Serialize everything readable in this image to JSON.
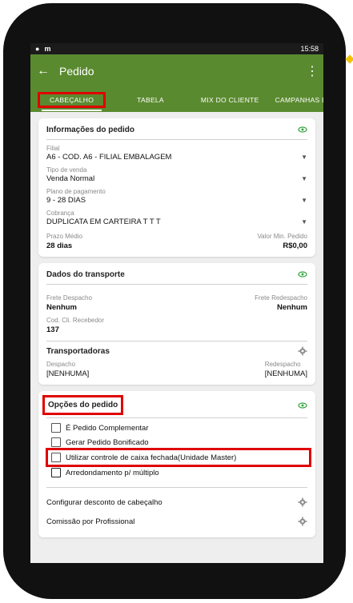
{
  "status": {
    "left_icon_a": "android-icon",
    "left_icon_b": "notification-icon",
    "time": "15:58"
  },
  "appbar": {
    "title": "Pedido"
  },
  "tabs": [
    "CABEÇALHO",
    "TABELA",
    "MIX DO CLIENTE",
    "CAMPANHAS DE"
  ],
  "info": {
    "title": "Informações do pedido",
    "filial_label": "Filial",
    "filial_value": "A6 - COD. A6 - FILIAL EMBALAGEM",
    "tipo_label": "Tipo de venda",
    "tipo_value": "Venda Normal",
    "plano_label": "Plano de pagamento",
    "plano_value": "9 - 28 DIAS",
    "cobranca_label": "Cobrança",
    "cobranca_value": "DUPLICATA EM CARTEIRA T T T",
    "prazo_label": "Prazo Médio",
    "prazo_value": "28 dias",
    "valor_label": "Valor Min. Pedido",
    "valor_value": "R$0,00"
  },
  "transporte": {
    "title": "Dados do transporte",
    "frete_desp_label": "Frete Despacho",
    "frete_desp_value": "Nenhum",
    "frete_redesp_label": "Frete Redespacho",
    "frete_redesp_value": "Nenhum",
    "cod_label": "Cod. Cli. Recebedor",
    "cod_value": "137",
    "transportadoras_title": "Transportadoras",
    "despacho_label": "Despacho",
    "despacho_value": "[NENHUMA]",
    "redespacho_label": "Redespacho",
    "redespacho_value": "[NENHUMA]"
  },
  "opcoes": {
    "title": "Opções do pedido",
    "checks": [
      "É Pedido Complementar",
      "Gerar Pedido Bonificado",
      "Utilizar controle de caixa fechada(Unidade Master)",
      "Arredondamento p/ múltiplo"
    ],
    "link1": "Configurar desconto de cabeçalho",
    "link2": "Comissão por Profissional"
  },
  "colors": {
    "accent": "#5a8a2f",
    "highlight": "#e00000",
    "eye": "#3aa546"
  }
}
